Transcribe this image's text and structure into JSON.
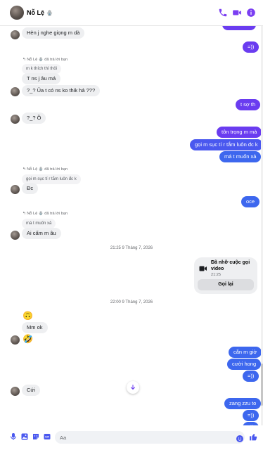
{
  "header": {
    "name": "Nỗ Lệ",
    "name_emoji": "🪬"
  },
  "colors": {
    "accent": "#6a3cf0",
    "accent_blue": "#3d67ee",
    "incoming_bg": "#eeeff1"
  },
  "messages": {
    "in_1": "Hèn j nghe giọng m dà",
    "out_1": "=))",
    "reply1_label": "Nỗ Lệ 🪬 đã trả lời bạn",
    "reply1_quote": "m k thích thì thôi",
    "in_2": "T ns j âu má",
    "in_3": "?_? Ủa t có ns ko thik hả ???",
    "out_2": "t sợ th",
    "in_4": "?_? Ồ",
    "out_3": "tôn trọng m mà",
    "out_4": "gọi m sục tí r tắm luôn đc k",
    "out_5": "má t muốn xả",
    "reply2_label": "Nỗ Lệ 🪬 đã trả lời bạn",
    "reply2_quote": "gọi m sục tí r tắm luôn đc k",
    "in_5": "Đc",
    "out_6": "oce",
    "reply3_label": "Nỗ Lệ 🪬 đã trả lời bạn",
    "reply3_quote": "má t muốn xả",
    "in_6": "Ai cấm m âu",
    "time_1": "21:25 9 Tháng 7, 2026",
    "call_title": "Đã nhỡ cuộc gọi video",
    "call_time": "21:25",
    "call_button": "Gọi lại",
    "time_2": "22:00 9 Tháng 7, 2026",
    "emoji_1": "🙃",
    "in_7": "Mm ok",
    "emoji_2": "🤣",
    "out_7": "cắn m giờ",
    "out_8": "cười hong",
    "out_9": "=))",
    "in_8": "Cứi",
    "out_10": "zang zzu to",
    "out_11": "=))",
    "out_12": "=))"
  },
  "composer": {
    "placeholder": "Aa"
  }
}
